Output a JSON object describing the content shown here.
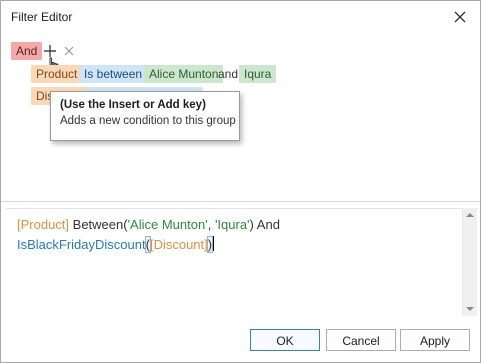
{
  "window": {
    "title": "Filter Editor"
  },
  "tree": {
    "group_operator": "And",
    "row1": {
      "field": "Product",
      "operator": "Is between",
      "value1": "Alice Munton",
      "conjunction": "and",
      "value2": "Iqura"
    },
    "row2": {
      "field": "Discount"
    }
  },
  "tooltip": {
    "title": "(Use the Insert or Add key)",
    "text": "Adds a new condition to this group"
  },
  "expression": {
    "line1": {
      "field": "[Product]",
      "func": "Between(",
      "str1": "'Alice Munton'",
      "sep": ", ",
      "str2": "'Iqura'",
      "close": ")",
      "keyword": "And"
    },
    "line2": {
      "func": "IsBlackFridayDiscount",
      "open": "(",
      "field": "[Discount]",
      "close": ")"
    }
  },
  "buttons": {
    "ok": "OK",
    "cancel": "Cancel",
    "apply": "Apply"
  },
  "colors": {
    "group": "#f3a9a9",
    "field": "#fbd8b8",
    "operator": "#cfe4f5",
    "value": "#cde7cf",
    "code_field": "#e09040",
    "code_func": "#2a7ab8",
    "code_string": "#2e8b3c"
  }
}
